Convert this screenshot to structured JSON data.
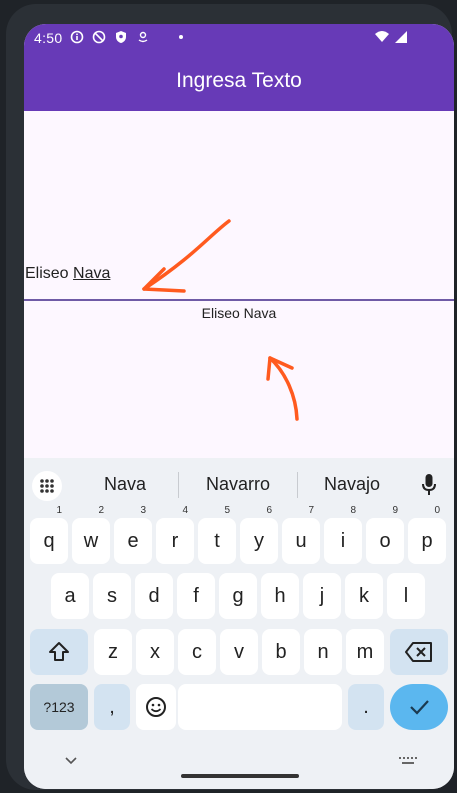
{
  "status_bar": {
    "time": "4:50",
    "icons": [
      "info-icon",
      "block-icon",
      "shield-icon",
      "location-icon",
      "dot-icon",
      "wifi-icon",
      "signal-icon"
    ]
  },
  "app_bar": {
    "title": "Ingresa Texto",
    "color": "#673ab7"
  },
  "text_field": {
    "value_part1": "Eliseo ",
    "value_part2": "Nava"
  },
  "echo_text": "Eliseo Nava",
  "annotations": {
    "arrow_color": "#ff5a1f"
  },
  "keyboard": {
    "suggestions": [
      "Nava",
      "Navarro",
      "Navajo"
    ],
    "row1": [
      {
        "k": "q",
        "n": "1"
      },
      {
        "k": "w",
        "n": "2"
      },
      {
        "k": "e",
        "n": "3"
      },
      {
        "k": "r",
        "n": "4"
      },
      {
        "k": "t",
        "n": "5"
      },
      {
        "k": "y",
        "n": "6"
      },
      {
        "k": "u",
        "n": "7"
      },
      {
        "k": "i",
        "n": "8"
      },
      {
        "k": "o",
        "n": "9"
      },
      {
        "k": "p",
        "n": "0"
      }
    ],
    "row2": [
      "a",
      "s",
      "d",
      "f",
      "g",
      "h",
      "j",
      "k",
      "l"
    ],
    "row3": [
      "z",
      "x",
      "c",
      "v",
      "b",
      "n",
      "m"
    ],
    "symbols_label": "?123",
    "comma_label": ",",
    "period_label": "."
  }
}
